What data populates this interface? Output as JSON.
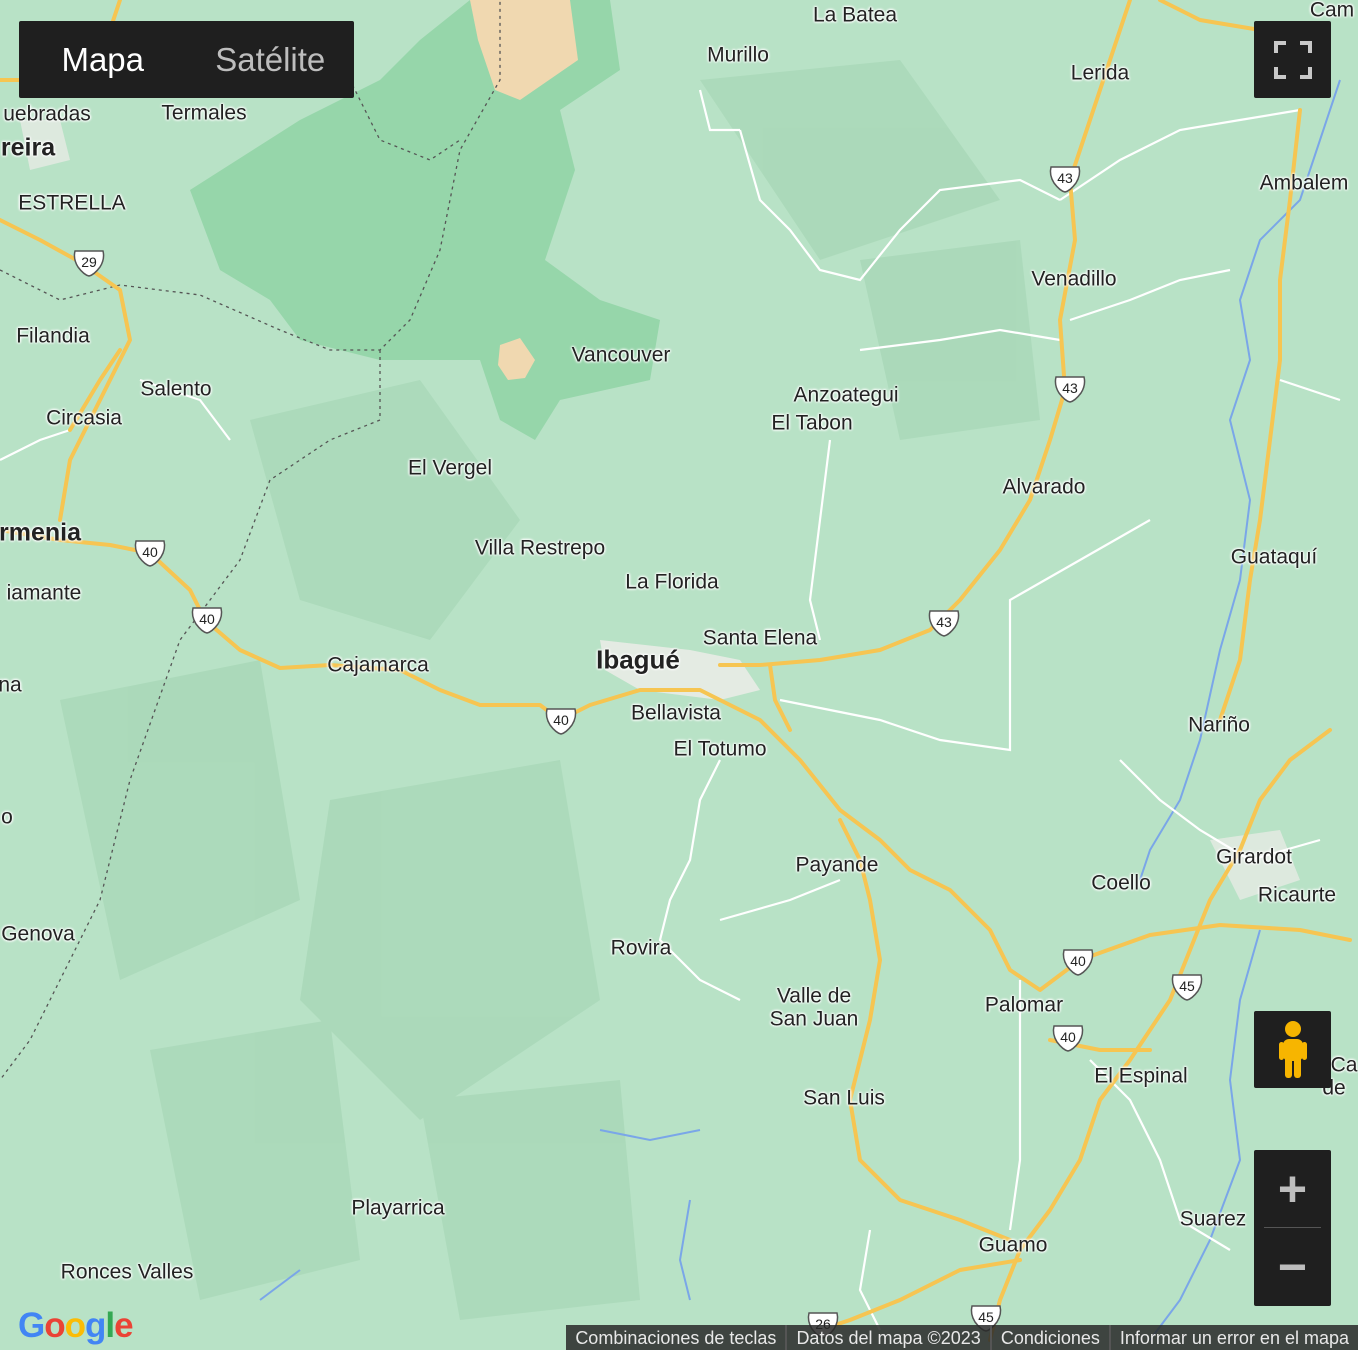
{
  "map_type": {
    "map_label": "Mapa",
    "satellite_label": "Satélite"
  },
  "labels": {
    "la_batea": "La Batea",
    "cam": "Cam",
    "murillo": "Murillo",
    "lerida": "Lerida",
    "quebradas": "uebradas",
    "termales": "Termales",
    "pereira": "reira",
    "estrella": "ESTRELLA",
    "ambalema": "Ambalem",
    "venadillo": "Venadillo",
    "filandia": "Filandia",
    "vancouver": "Vancouver",
    "salento": "Salento",
    "anzoategui": "Anzoategui",
    "el_tabon": "El Tabon",
    "circasia": "Circasia",
    "el_vergel": "El Vergel",
    "alvarado": "Alvarado",
    "armenia": "rmenia",
    "villa_restrepo": "Villa Restrepo",
    "guataqui": "Guataquí",
    "diamante": "iamante",
    "la_florida": "La Florida",
    "santa_elena": "Santa Elena",
    "ibague": "Ibagué",
    "cajamarca": "Cajamarca",
    "na": "na",
    "bellavista": "Bellavista",
    "narino": "Nariño",
    "el_totumo": "El Totumo",
    "o_edge": "o",
    "girardot": "Girardot",
    "payande": "Payande",
    "coello": "Coello",
    "ricaurte": "Ricaurte",
    "genova": "Genova",
    "rovira": "Rovira",
    "valle_de_san_juan_1": "Valle de",
    "valle_de_san_juan_2": "San Juan",
    "palomar": "Palomar",
    "el_espinal": "El Espinal",
    "ca_edge_1": "Ca",
    "ca_edge_2": "de",
    "san_luis": "San Luis",
    "playarrica": "Playarrica",
    "suarez": "Suarez",
    "guamo": "Guamo",
    "ronces_valles": "Ronces Valles"
  },
  "routes": {
    "r29": "29",
    "r43a": "43",
    "r43b": "43",
    "r43c": "43",
    "r40a": "40",
    "r40b": "40",
    "r40c": "40",
    "r40d": "40",
    "r40e": "40",
    "r45a": "45",
    "r45b": "45",
    "r26": "26"
  },
  "controls": {
    "fullscreen_icon": "fullscreen-icon",
    "pegman_icon": "pegman-icon",
    "zoom_in": "+",
    "zoom_out": "−"
  },
  "footer": {
    "shortcuts": "Combinaciones de teclas",
    "map_data": "Datos del mapa ©2023",
    "terms": "Condiciones",
    "report": "Informar un error en el mapa"
  },
  "logo": {
    "G": "G",
    "o1": "o",
    "o2": "o",
    "g": "g",
    "l": "l",
    "e": "e"
  },
  "colors": {
    "terrain": "#b8e2c6",
    "park": "#8fd4a4",
    "peak": "#f0d8b0",
    "highway": "#f6c552",
    "road": "#ffffff",
    "river": "#7aa6e8",
    "control_bg": "#1f1f1f"
  }
}
